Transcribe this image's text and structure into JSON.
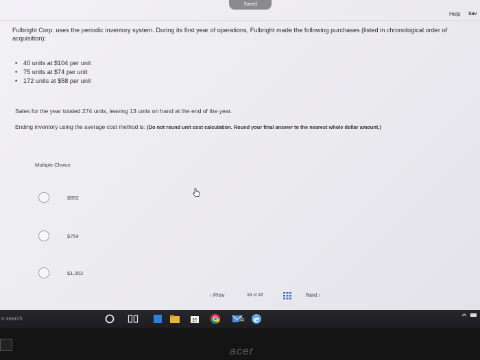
{
  "header": {
    "saved_badge": "Saved",
    "help_label": "Help",
    "save_label": "Sav"
  },
  "question": {
    "intro": "Fulbright Corp. uses the periodic inventory system. During its first year of operations, Fulbright made the following purchases (listed in chronological order of acquisition):",
    "purchases": [
      "40 units at $104 per unit",
      "75 units at $74 per unit",
      "172 units at $58 per unit"
    ],
    "sales": "Sales for the year totaled 274 units, leaving 13 units on hand at the end of the year.",
    "ending_prompt": "Ending inventory using the average cost method is:",
    "ending_instruction": "(Do not round unit cost calculation. Round your final answer to the nearest whole dollar amount.)"
  },
  "multiple_choice": {
    "title": "Multiple Choice",
    "options": [
      {
        "label": "$892"
      },
      {
        "label": "$754"
      },
      {
        "label": "$1,352"
      }
    ]
  },
  "nav": {
    "prev_label": "Prev",
    "page_current": "10",
    "page_of": "of",
    "page_total": "47",
    "next_label": "Next"
  },
  "taskbar": {
    "search_hint": "o search",
    "badge_count": "82"
  },
  "bezel": {
    "brand": "acer"
  },
  "colors": {
    "screen_bg": "#eeedf2",
    "taskbar_bg": "#222226",
    "accent_blue": "#3b6fd1"
  }
}
